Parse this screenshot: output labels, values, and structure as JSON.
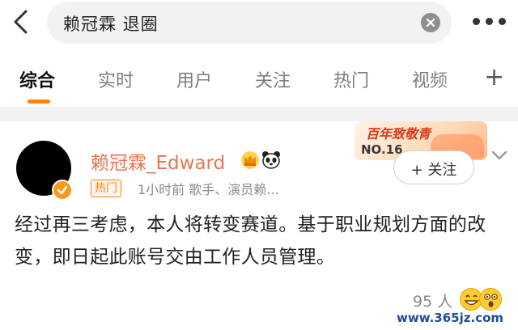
{
  "search": {
    "query": "赖冠霖 退圈"
  },
  "tabs": [
    {
      "label": "综合",
      "active": true
    },
    {
      "label": "实时",
      "active": false
    },
    {
      "label": "用户",
      "active": false
    },
    {
      "label": "关注",
      "active": false
    },
    {
      "label": "热门",
      "active": false
    },
    {
      "label": "视频",
      "active": false
    }
  ],
  "tab_plus_label": "+",
  "colors": {
    "accent": "#ff8200",
    "username": "#eb7350",
    "divider": "#f2f2f2"
  },
  "post": {
    "username": "赖冠霖_Edward",
    "tag": "热门",
    "meta": "1小时前  歌手、演员赖...",
    "text": "经过再三考虑，本人将转变赛道。基于职业规划方面的改变，即日起此账号交由工作人员管理。",
    "follow_label": "+ 关注",
    "like_count": "95 人",
    "promo": {
      "title": "百年致敬青",
      "number": "NO.16"
    }
  },
  "watermark": "www.365jz.com"
}
